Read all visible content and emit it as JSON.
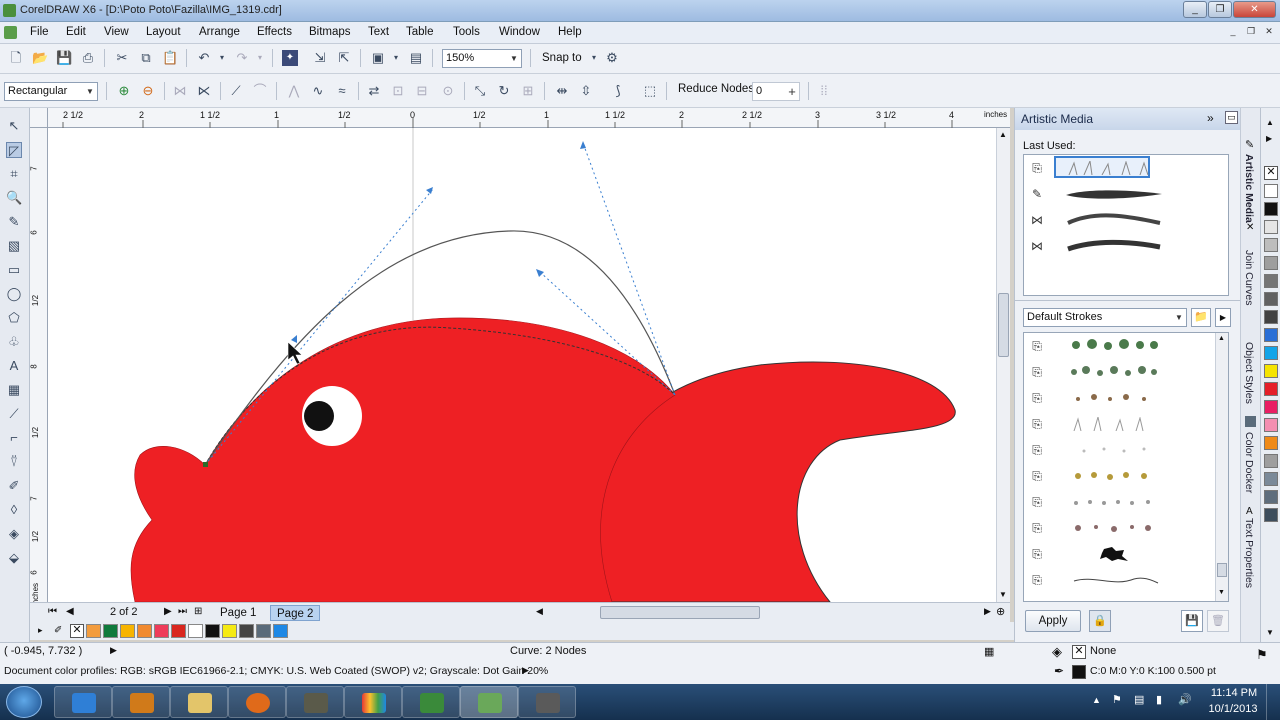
{
  "window": {
    "title": "CorelDRAW X6 - [D:\\Poto Poto\\Fazilla\\IMG_1319.cdr]",
    "controls": [
      "_",
      "❐",
      "✕"
    ],
    "doc_controls": [
      "_",
      "❐",
      "✕"
    ]
  },
  "menu": {
    "items": [
      "File",
      "Edit",
      "View",
      "Layout",
      "Arrange",
      "Effects",
      "Bitmaps",
      "Text",
      "Table",
      "Tools",
      "Window",
      "Help"
    ]
  },
  "standard_toolbar": {
    "zoom": "150%",
    "snap_to": "Snap to"
  },
  "property_bar": {
    "selection_mode": "Rectangular",
    "reduce_nodes_label": "Reduce Nodes",
    "reduce_nodes_value": "0"
  },
  "rulers": {
    "horizontal_ticks": [
      "2 1/2",
      "2",
      "1 1/2",
      "1",
      "1/2",
      "0",
      "1/2",
      "1",
      "1 1/2",
      "2",
      "2 1/2",
      "3",
      "3 1/2",
      "4"
    ],
    "horizontal_unit": "inches",
    "vertical_ticks": [
      "7",
      "6",
      "1/2",
      "8",
      "1/2",
      "7",
      "1/2",
      "6"
    ],
    "vertical_unit": "inches"
  },
  "page_navigator": {
    "page_count": "2 of 2",
    "tabs": [
      "Page 1",
      "Page 2"
    ],
    "active_tab": "Page 2"
  },
  "status": {
    "coordinates": "( -0.945, 7.732 )",
    "selection_info": "Curve: 2 Nodes",
    "color_profiles": "Document color profiles: RGB: sRGB IEC61966-2.1; CMYK: U.S. Web Coated (SWOP) v2; Grayscale: Dot Gain 20%",
    "fill_label": "None",
    "outline_info": "C:0 M:0 Y:0 K:100  0.500 pt"
  },
  "docker": {
    "title": "Artistic Media",
    "last_used_label": "Last Used:",
    "stroke_category": "Default Strokes",
    "apply_button": "Apply"
  },
  "docker_tabs": [
    "Artistic Media",
    "Join Curves",
    "Object Styles",
    "Color Docker",
    "Text Properties"
  ],
  "taskbar": {
    "time": "11:14 PM",
    "date": "10/1/2013"
  },
  "colors": {
    "fish_body": "#ee2024",
    "eye_pupil": "#111111",
    "handle_line": "#3a7fd0",
    "canvas": "#ffffff",
    "docker_header": "#c8d6ea"
  },
  "bottom_palette": [
    "#f39c3d",
    "#0f7a3c",
    "#f7b400",
    "#f18a2f",
    "#ee3c5a",
    "#d9271f",
    "#ffffff",
    "#111111",
    "#f5ea14",
    "#444444",
    "#5a6b7a",
    "#1e88e5"
  ],
  "right_palette": [
    "#ffffff",
    "#111111",
    "#e5e5e5",
    "#bdbdbd",
    "#9e9e9e",
    "#757575",
    "#616161",
    "#424242",
    "#2a6fd6",
    "#13a4e8",
    "#f5e400",
    "#e5202a",
    "#e91e63",
    "#f48fb1",
    "#ef8a18",
    "#9e9e9e",
    "#7b8a99",
    "#5e6d7c",
    "#3d4d5c"
  ]
}
